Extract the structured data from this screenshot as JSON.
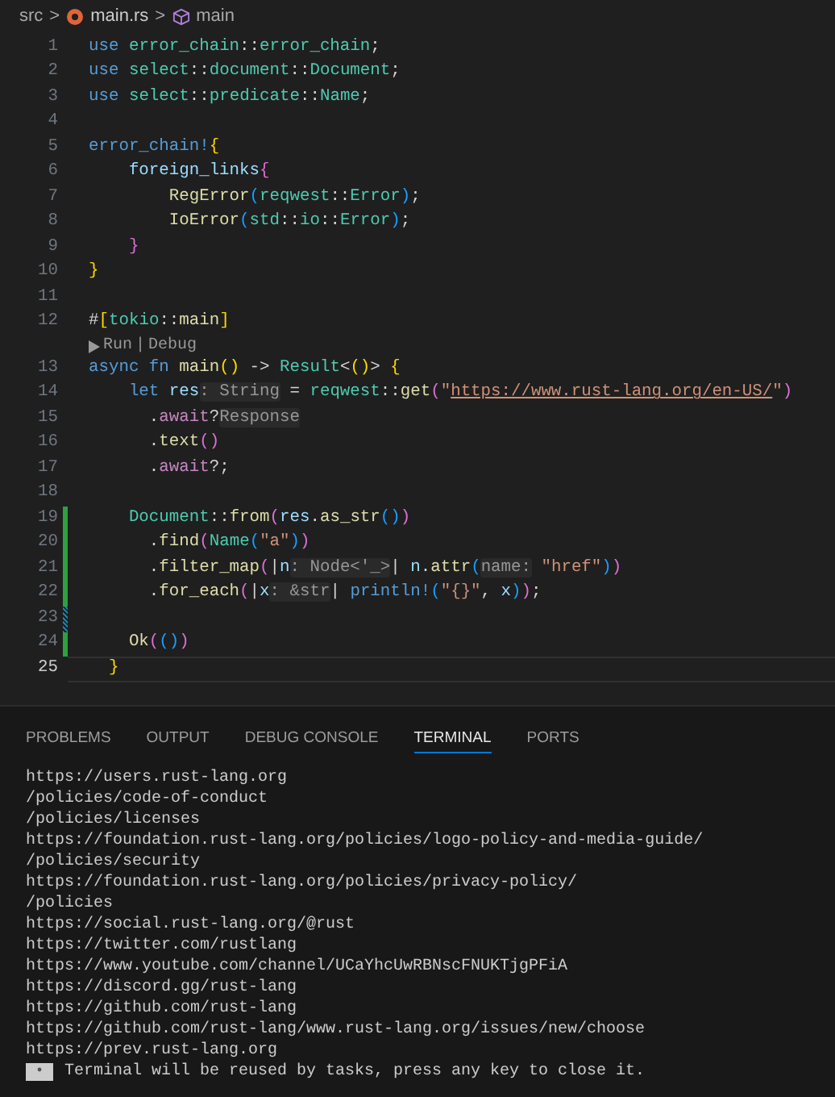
{
  "breadcrumb": {
    "folder": "src",
    "separator": ">",
    "file": "main.rs",
    "symbol": "main"
  },
  "editor": {
    "lines": [
      {
        "kind": "code",
        "number": "1",
        "added": false,
        "modified": false,
        "current": false,
        "tokens": [
          {
            "kind": "kw",
            "text": "use "
          },
          {
            "kind": "ns",
            "text": "error_chain"
          },
          {
            "kind": "p",
            "text": "::"
          },
          {
            "kind": "ns",
            "text": "error_chain"
          },
          {
            "kind": "p",
            "text": ";"
          }
        ]
      },
      {
        "kind": "code",
        "number": "2",
        "added": false,
        "modified": false,
        "current": false,
        "tokens": [
          {
            "kind": "kw",
            "text": "use "
          },
          {
            "kind": "ns",
            "text": "select"
          },
          {
            "kind": "p",
            "text": "::"
          },
          {
            "kind": "ns",
            "text": "document"
          },
          {
            "kind": "p",
            "text": "::"
          },
          {
            "kind": "ns",
            "text": "Document"
          },
          {
            "kind": "p",
            "text": ";"
          }
        ]
      },
      {
        "kind": "code",
        "number": "3",
        "added": false,
        "modified": false,
        "current": false,
        "tokens": [
          {
            "kind": "kw",
            "text": "use "
          },
          {
            "kind": "ns",
            "text": "select"
          },
          {
            "kind": "p",
            "text": "::"
          },
          {
            "kind": "ns",
            "text": "predicate"
          },
          {
            "kind": "p",
            "text": "::"
          },
          {
            "kind": "ns",
            "text": "Name"
          },
          {
            "kind": "p",
            "text": ";"
          }
        ]
      },
      {
        "kind": "code",
        "number": "4",
        "added": false,
        "modified": false,
        "current": false
      },
      {
        "kind": "code",
        "number": "5",
        "added": false,
        "modified": false,
        "current": false,
        "tokens": [
          {
            "kind": "macro",
            "text": "error_chain!"
          },
          {
            "kind": "b1",
            "text": "{"
          }
        ]
      },
      {
        "kind": "code",
        "number": "6",
        "added": false,
        "modified": false,
        "current": false,
        "tokens": [
          {
            "kind": "var",
            "text": "    foreign_links"
          },
          {
            "kind": "b2",
            "text": "{"
          }
        ]
      },
      {
        "kind": "code",
        "number": "7",
        "added": false,
        "modified": false,
        "current": false,
        "tokens": [
          {
            "kind": "fn",
            "text": "        RegError"
          },
          {
            "kind": "b3",
            "text": "("
          },
          {
            "kind": "ns",
            "text": "reqwest"
          },
          {
            "kind": "p",
            "text": "::"
          },
          {
            "kind": "ns",
            "text": "Error"
          },
          {
            "kind": "b3",
            "text": ")"
          },
          {
            "kind": "p",
            "text": ";"
          }
        ]
      },
      {
        "kind": "code",
        "number": "8",
        "added": false,
        "modified": false,
        "current": false,
        "tokens": [
          {
            "kind": "fn",
            "text": "        IoError"
          },
          {
            "kind": "b3",
            "text": "("
          },
          {
            "kind": "ns",
            "text": "std"
          },
          {
            "kind": "p",
            "text": "::"
          },
          {
            "kind": "ns",
            "text": "io"
          },
          {
            "kind": "p",
            "text": "::"
          },
          {
            "kind": "ns",
            "text": "Error"
          },
          {
            "kind": "b3",
            "text": ")"
          },
          {
            "kind": "p",
            "text": ";"
          }
        ]
      },
      {
        "kind": "code",
        "number": "9",
        "added": false,
        "modified": false,
        "current": false,
        "tokens": [
          {
            "kind": "b2",
            "text": "    }"
          }
        ]
      },
      {
        "kind": "code",
        "number": "10",
        "added": false,
        "modified": false,
        "current": false,
        "tokens": [
          {
            "kind": "b1",
            "text": "}"
          }
        ]
      },
      {
        "kind": "code",
        "number": "11",
        "added": false,
        "modified": false,
        "current": false
      },
      {
        "kind": "code",
        "number": "12",
        "added": false,
        "modified": false,
        "current": false,
        "tokens": [
          {
            "kind": "p",
            "text": "#"
          },
          {
            "kind": "b1",
            "text": "["
          },
          {
            "kind": "ns",
            "text": "tokio"
          },
          {
            "kind": "p",
            "text": "::"
          },
          {
            "kind": "fn",
            "text": "main"
          },
          {
            "kind": "b1",
            "text": "]"
          }
        ]
      },
      {
        "kind": "codelens",
        "actions": [
          "Run",
          "Debug"
        ],
        "separator": "|"
      },
      {
        "kind": "code",
        "number": "13",
        "added": false,
        "modified": false,
        "current": false,
        "tokens": [
          {
            "kind": "kw",
            "text": "async fn "
          },
          {
            "kind": "fn",
            "text": "main"
          },
          {
            "kind": "b1",
            "text": "()"
          },
          {
            "kind": "p",
            "text": " -> "
          },
          {
            "kind": "ns",
            "text": "Result"
          },
          {
            "kind": "p",
            "text": "<"
          },
          {
            "kind": "b1",
            "text": "()"
          },
          {
            "kind": "p",
            "text": "> "
          },
          {
            "kind": "b1",
            "text": "{"
          }
        ]
      },
      {
        "kind": "code",
        "number": "14",
        "added": false,
        "modified": false,
        "current": false,
        "tokens": [
          {
            "kind": "kw",
            "text": "    let "
          },
          {
            "kind": "var",
            "text": "res"
          },
          {
            "kind": "hint",
            "text": ": String"
          },
          {
            "kind": "p",
            "text": " = "
          },
          {
            "kind": "ns",
            "text": "reqwest"
          },
          {
            "kind": "p",
            "text": "::"
          },
          {
            "kind": "fn",
            "text": "get"
          },
          {
            "kind": "b2",
            "text": "("
          },
          {
            "kind": "str",
            "text": "\""
          },
          {
            "kind": "link",
            "text": "https://www.rust-lang.org/en-US/"
          },
          {
            "kind": "str",
            "text": "\""
          },
          {
            "kind": "b2",
            "text": ")"
          }
        ]
      },
      {
        "kind": "code",
        "number": "15",
        "added": false,
        "modified": false,
        "current": false,
        "tokens": [
          {
            "kind": "p",
            "text": "      ."
          },
          {
            "kind": "ctl",
            "text": "await"
          },
          {
            "kind": "p",
            "text": "?"
          },
          {
            "kind": "hint",
            "text": "Response"
          }
        ]
      },
      {
        "kind": "code",
        "number": "16",
        "added": false,
        "modified": false,
        "current": false,
        "tokens": [
          {
            "kind": "p",
            "text": "      ."
          },
          {
            "kind": "fn",
            "text": "text"
          },
          {
            "kind": "b2",
            "text": "()"
          }
        ]
      },
      {
        "kind": "code",
        "number": "17",
        "added": false,
        "modified": false,
        "current": false,
        "tokens": [
          {
            "kind": "p",
            "text": "      ."
          },
          {
            "kind": "ctl",
            "text": "await"
          },
          {
            "kind": "p",
            "text": "?;"
          }
        ]
      },
      {
        "kind": "code",
        "number": "18",
        "added": false,
        "modified": false,
        "current": false
      },
      {
        "kind": "code",
        "number": "19",
        "added": true,
        "modified": false,
        "current": false,
        "tokens": [
          {
            "kind": "ns",
            "text": "    Document"
          },
          {
            "kind": "p",
            "text": "::"
          },
          {
            "kind": "fn",
            "text": "from"
          },
          {
            "kind": "b2",
            "text": "("
          },
          {
            "kind": "var",
            "text": "res"
          },
          {
            "kind": "p",
            "text": "."
          },
          {
            "kind": "fn",
            "text": "as_str"
          },
          {
            "kind": "b3",
            "text": "()"
          },
          {
            "kind": "b2",
            "text": ")"
          }
        ]
      },
      {
        "kind": "code",
        "number": "20",
        "added": true,
        "modified": false,
        "current": false,
        "tokens": [
          {
            "kind": "p",
            "text": "      ."
          },
          {
            "kind": "fn",
            "text": "find"
          },
          {
            "kind": "b2",
            "text": "("
          },
          {
            "kind": "ns",
            "text": "Name"
          },
          {
            "kind": "b3",
            "text": "("
          },
          {
            "kind": "str",
            "text": "\"a\""
          },
          {
            "kind": "b3",
            "text": ")"
          },
          {
            "kind": "b2",
            "text": ")"
          }
        ]
      },
      {
        "kind": "code",
        "number": "21",
        "added": true,
        "modified": false,
        "current": false,
        "tokens": [
          {
            "kind": "p",
            "text": "      ."
          },
          {
            "kind": "fn",
            "text": "filter_map"
          },
          {
            "kind": "b2",
            "text": "("
          },
          {
            "kind": "p",
            "text": "|"
          },
          {
            "kind": "var",
            "text": "n"
          },
          {
            "kind": "hint",
            "text": ": Node<'_>"
          },
          {
            "kind": "p",
            "text": "| "
          },
          {
            "kind": "var",
            "text": "n"
          },
          {
            "kind": "p",
            "text": "."
          },
          {
            "kind": "fn",
            "text": "attr"
          },
          {
            "kind": "b3",
            "text": "("
          },
          {
            "kind": "hint",
            "text": "name:"
          },
          {
            "kind": "str",
            "text": " \"href\""
          },
          {
            "kind": "b3",
            "text": ")"
          },
          {
            "kind": "b2",
            "text": ")"
          }
        ]
      },
      {
        "kind": "code",
        "number": "22",
        "added": true,
        "modified": false,
        "current": false,
        "tokens": [
          {
            "kind": "p",
            "text": "      ."
          },
          {
            "kind": "fn",
            "text": "for_each"
          },
          {
            "kind": "b2",
            "text": "("
          },
          {
            "kind": "p",
            "text": "|"
          },
          {
            "kind": "var",
            "text": "x"
          },
          {
            "kind": "hint",
            "text": ": &str"
          },
          {
            "kind": "p",
            "text": "| "
          },
          {
            "kind": "macro",
            "text": "println!"
          },
          {
            "kind": "b3",
            "text": "("
          },
          {
            "kind": "str",
            "text": "\"{}\""
          },
          {
            "kind": "p",
            "text": ", "
          },
          {
            "kind": "var",
            "text": "x"
          },
          {
            "kind": "b3",
            "text": ")"
          },
          {
            "kind": "b2",
            "text": ")"
          },
          {
            "kind": "p",
            "text": ";"
          }
        ]
      },
      {
        "kind": "code",
        "number": "23",
        "added": false,
        "modified": true,
        "current": false
      },
      {
        "kind": "code",
        "number": "24",
        "added": true,
        "modified": false,
        "current": false,
        "tokens": [
          {
            "kind": "fn",
            "text": "    Ok"
          },
          {
            "kind": "b2",
            "text": "("
          },
          {
            "kind": "b3",
            "text": "()"
          },
          {
            "kind": "b2",
            "text": ")"
          }
        ]
      },
      {
        "kind": "code",
        "number": "25",
        "added": false,
        "modified": false,
        "current": true,
        "tokens": [
          {
            "kind": "b1",
            "text": "  }"
          }
        ]
      }
    ]
  },
  "panel": {
    "tabs": [
      {
        "label": "PROBLEMS",
        "selected": false
      },
      {
        "label": "OUTPUT",
        "selected": false
      },
      {
        "label": "DEBUG CONSOLE",
        "selected": false
      },
      {
        "label": "TERMINAL",
        "selected": true
      },
      {
        "label": "PORTS",
        "selected": false
      }
    ],
    "terminal": {
      "lines": [
        "https://users.rust-lang.org",
        "/policies/code-of-conduct",
        "/policies/licenses",
        "https://foundation.rust-lang.org/policies/logo-policy-and-media-guide/",
        "/policies/security",
        "https://foundation.rust-lang.org/policies/privacy-policy/",
        "/policies",
        "https://social.rust-lang.org/@rust",
        "https://twitter.com/rustlang",
        "https://www.youtube.com/channel/UCaYhcUwRBNscFNUKTjgPFiA",
        "https://discord.gg/rust-lang",
        "https://github.com/rust-lang",
        "https://github.com/rust-lang/www.rust-lang.org/issues/new/choose",
        "https://prev.rust-lang.org"
      ],
      "notice": "Terminal will be reused by tasks, press any key to close it."
    }
  }
}
